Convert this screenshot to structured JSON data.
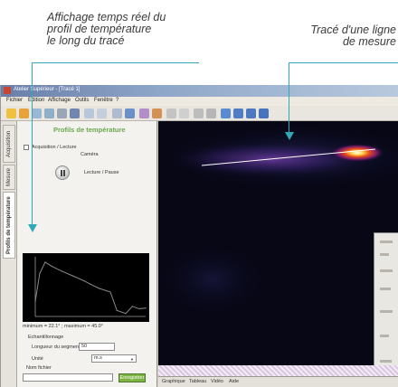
{
  "annotations": {
    "left_caption": [
      "Affichage temps réel du",
      "profil de température",
      "le long du tracé"
    ],
    "right_caption": [
      "Tracé d'une ligne",
      "de mesure"
    ],
    "accent_color": "#2fa9b6"
  },
  "window": {
    "title": "Atelier Supérieur - [Tracé 1]",
    "menu": [
      "Fichier",
      "Edition",
      "Affichage",
      "Outils",
      "Fenêtre",
      "?"
    ]
  },
  "side_tabs": [
    "Acquisition",
    "Mesure",
    "Profils de température"
  ],
  "panel": {
    "title": "Profils de température",
    "acquisition_label": "Acquisition / Lecture",
    "camera_label": "Caméra",
    "play_pause_label": "Lecture / Pause",
    "min_max_text": "minimum = 22.1° ; maximum = 45.0°",
    "sampling_heading": "Echantillonnage",
    "segment_length_label": "Longueur du segment",
    "segment_length_value": "50",
    "unit_label": "Unité",
    "unit_value": "m.s",
    "filename_label": "Nom fichier",
    "filename_value": "",
    "save_button": "Enregistrer"
  },
  "profile_plot": {
    "type": "line",
    "x": [
      0,
      0.04,
      0.09,
      0.15,
      0.24,
      0.34,
      0.44,
      0.5,
      0.58,
      0.68,
      0.74,
      0.82,
      0.88,
      0.94,
      1
    ],
    "y": [
      0.25,
      0.72,
      0.91,
      0.84,
      0.76,
      0.68,
      0.6,
      0.54,
      0.47,
      0.41,
      0.1,
      0.05,
      0.17,
      0.13,
      0.14
    ],
    "series_color": "#8a8a8a",
    "grid": false
  },
  "bottom_tabs": [
    "Graphique",
    "Tableau",
    "Vidéo",
    "Aide"
  ]
}
